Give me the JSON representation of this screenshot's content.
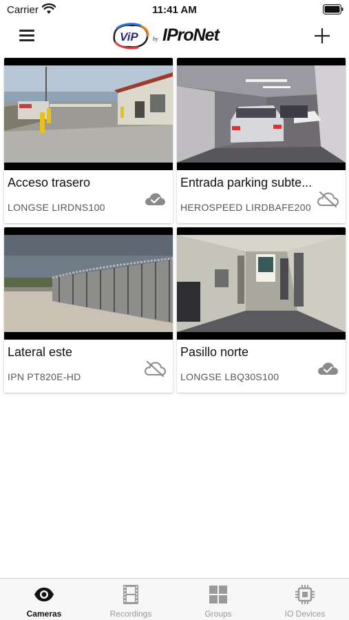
{
  "status_bar": {
    "carrier": "Carrier",
    "time": "11:41 AM"
  },
  "header": {
    "logo_vip": "ViP",
    "logo_by": "by",
    "logo_brand": "IProNet",
    "menu_icon": "hamburger-menu-icon",
    "add_icon": "plus-icon"
  },
  "cameras": [
    {
      "title": "Acceso trasero",
      "model": "LONGSE LIRDNS100",
      "status": "online",
      "status_icon": "cloud-check-icon"
    },
    {
      "title": "Entrada parking subte...",
      "model": "HEROSPEED LIRDBAFE200",
      "status": "offline",
      "status_icon": "cloud-off-icon"
    },
    {
      "title": "Lateral este",
      "model": "IPN PT820E-HD",
      "status": "offline",
      "status_icon": "cloud-off-icon"
    },
    {
      "title": "Pasillo norte",
      "model": "LONGSE LBQ30S100",
      "status": "online",
      "status_icon": "cloud-check-icon"
    }
  ],
  "tabs": [
    {
      "label": "Cameras",
      "icon": "eye-icon",
      "active": true
    },
    {
      "label": "Recordings",
      "icon": "film-icon",
      "active": false
    },
    {
      "label": "Groups",
      "icon": "grid-icon",
      "active": false
    },
    {
      "label": "IO Devices",
      "icon": "chip-icon",
      "active": false
    }
  ],
  "colors": {
    "active_tab": "#111111",
    "inactive_tab": "#9a9a9a",
    "cloud_icon": "#8a8a8a"
  }
}
